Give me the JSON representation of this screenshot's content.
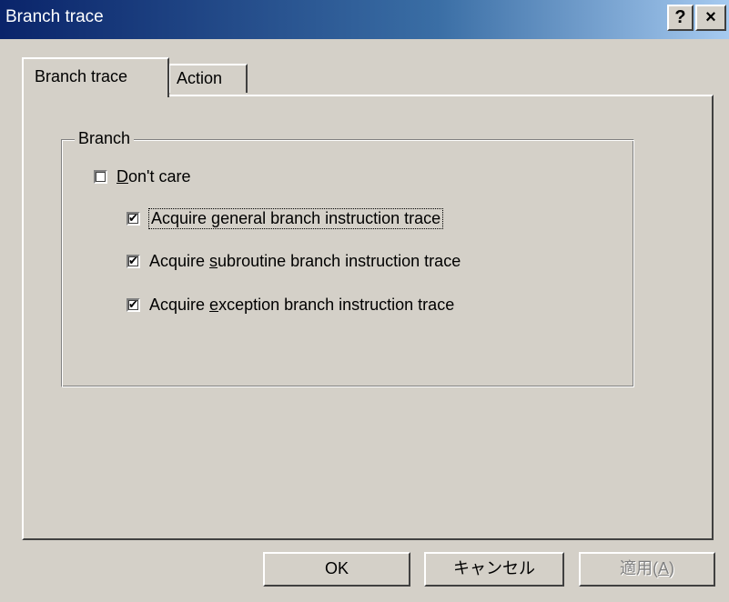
{
  "window": {
    "title": "Branch trace",
    "help_label": "?",
    "close_label": "×"
  },
  "tabs": [
    {
      "label": "Branch trace",
      "active": true
    },
    {
      "label": "Action",
      "active": false
    }
  ],
  "group": {
    "label": "Branch",
    "options": [
      {
        "label": "Don't care",
        "checked": false
      },
      {
        "label": "Acquire general branch instruction trace",
        "checked": true,
        "focused": true
      },
      {
        "label": "Acquire subroutine branch instruction trace",
        "checked": true
      },
      {
        "label": "Acquire exception branch instruction trace",
        "checked": true
      }
    ]
  },
  "buttons": {
    "ok": "OK",
    "cancel": "キャンセル",
    "apply": "適用(A)",
    "apply_enabled": false
  },
  "check_glyph": "✔"
}
